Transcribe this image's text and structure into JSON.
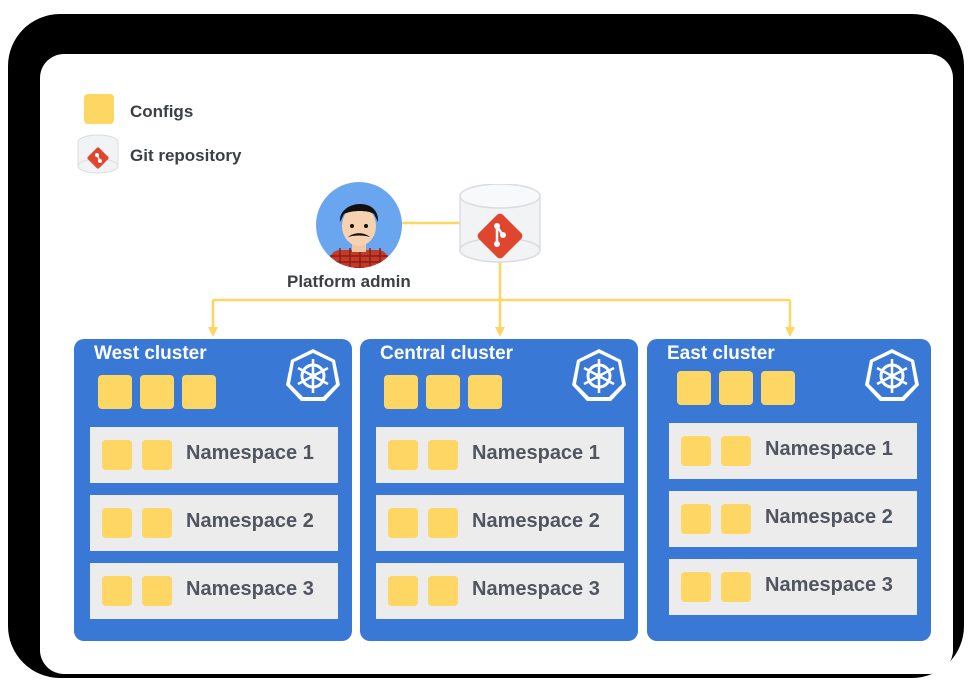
{
  "colors": {
    "config": "#fdd663",
    "cluster": "#3a78d6",
    "namespace_bg": "#ececec",
    "arrow": "#fdd663",
    "git_red": "#e0452e"
  },
  "legend": {
    "configs_label": "Configs",
    "git_label": "Git repository"
  },
  "admin": {
    "label": "Platform admin",
    "icon": "person-avatar-icon"
  },
  "repo": {
    "icon": "git-repository-icon"
  },
  "clusters": [
    {
      "title": "West cluster",
      "config_count": 3,
      "namespaces": [
        "Namespace 1",
        "Namespace 2",
        "Namespace 3"
      ]
    },
    {
      "title": "Central cluster",
      "config_count": 3,
      "namespaces": [
        "Namespace 1",
        "Namespace 2",
        "Namespace 3"
      ]
    },
    {
      "title": "East cluster",
      "config_count": 3,
      "namespaces": [
        "Namespace 1",
        "Namespace 2",
        "Namespace 3"
      ]
    }
  ]
}
